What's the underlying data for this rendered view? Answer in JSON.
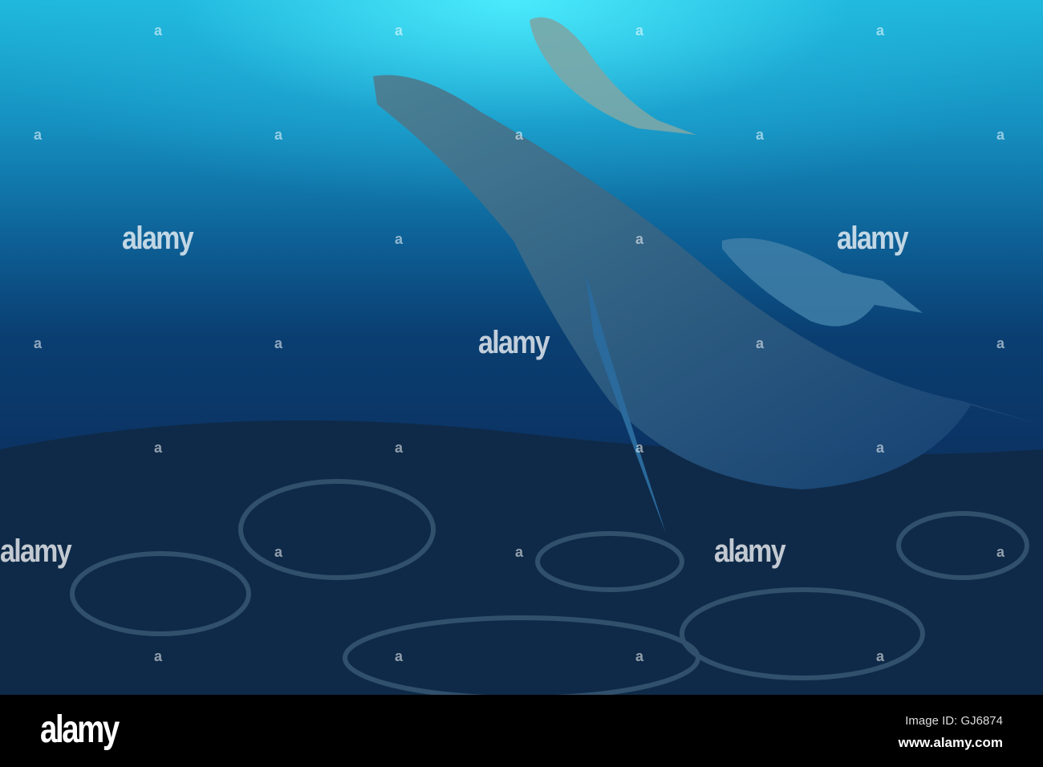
{
  "watermark": {
    "text": "alamy",
    "mark": "a"
  },
  "footer": {
    "logo": "alamy",
    "image_id": "Image ID: GJ6874",
    "website": "www.alamy.com"
  }
}
